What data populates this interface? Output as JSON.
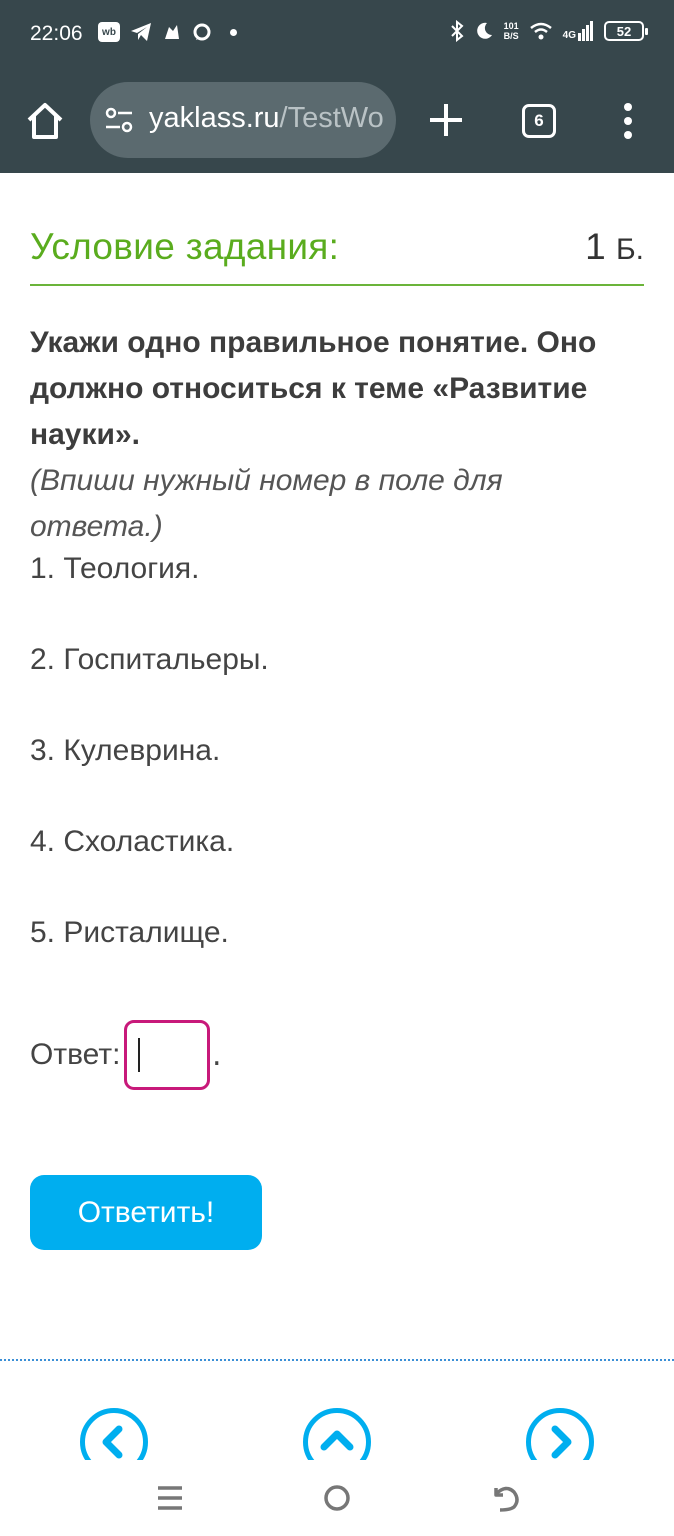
{
  "status_bar": {
    "time": "22:06",
    "wb_badge": "wb",
    "net_speed_top": "101",
    "net_speed_bottom": "B/S",
    "signal_label": "4G",
    "battery": "52"
  },
  "browser": {
    "url_host": "yaklass.ru",
    "url_path": "/TestWo",
    "tab_count": "6"
  },
  "task": {
    "title": "Условие задания:",
    "points_value": "1",
    "points_unit": "Б."
  },
  "question": {
    "text": "Укажи одно правильное понятие. Оно должно относиться к теме «Развитие науки».",
    "hint": "(Впиши нужный номер в поле для ответа.)"
  },
  "options": [
    "1. Теология.",
    "2. Госпитальеры.",
    "3. Кулеврина.",
    "4. Схоластика.",
    "5. Ристалище."
  ],
  "answer": {
    "label": "Ответ:",
    "value": "",
    "suffix": "."
  },
  "submit_label": "Ответить!",
  "colors": {
    "header_bg": "#37474c",
    "title_green": "#5aac1e",
    "accent_blue": "#00aeef",
    "input_border": "#c8197a"
  }
}
